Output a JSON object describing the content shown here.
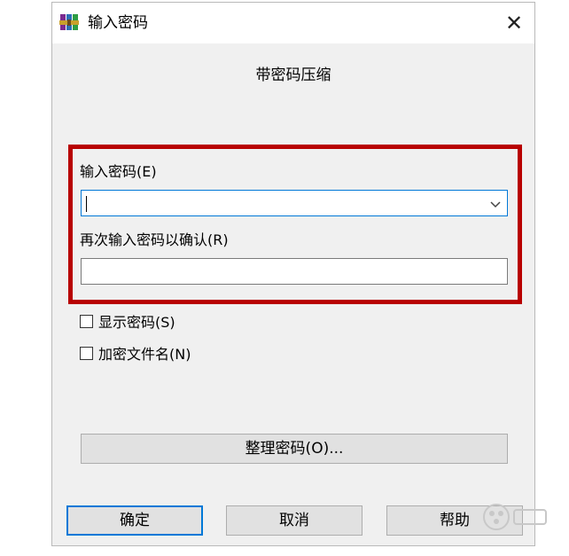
{
  "window": {
    "title": "输入密码",
    "app_icon": "winrar-books-icon",
    "close_glyph": "✕"
  },
  "heading": "带密码压缩",
  "fields": {
    "password_label": "输入密码(E)",
    "password_value": "",
    "confirm_label": "再次输入密码以确认(R)",
    "confirm_value": ""
  },
  "checkboxes": [
    {
      "label": "显示密码(S)",
      "checked": false
    },
    {
      "label": "加密文件名(N)",
      "checked": false
    }
  ],
  "organize_button": "整理密码(O)...",
  "buttons": {
    "ok": "确定",
    "cancel": "取消",
    "help": "帮助"
  },
  "colors": {
    "highlight": "#b80000",
    "focus_blue": "#0078d7"
  }
}
